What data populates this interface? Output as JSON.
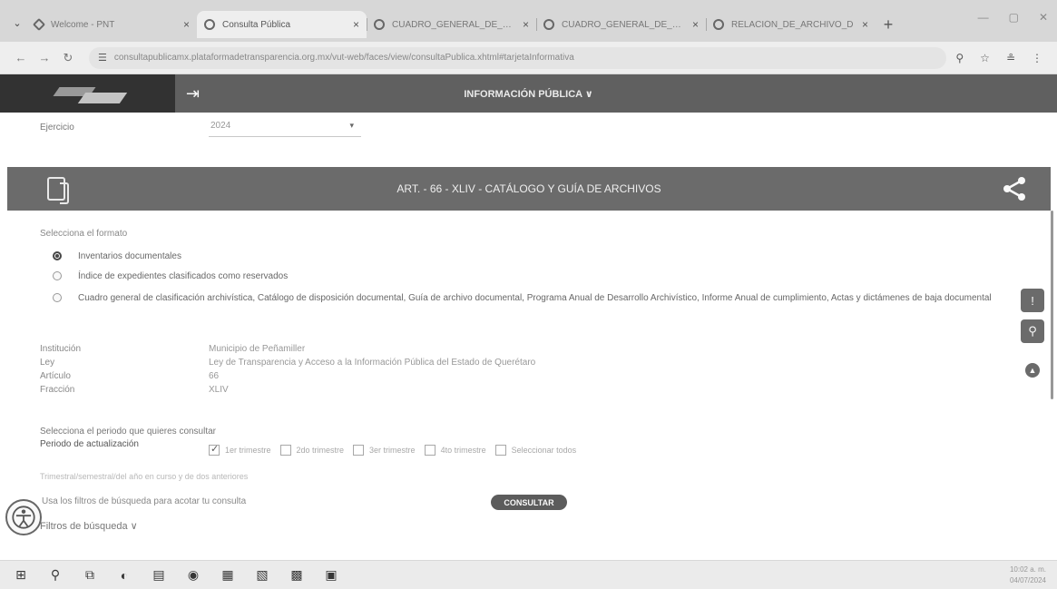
{
  "browser": {
    "tabs": [
      {
        "title": "Welcome - PNT",
        "active": false
      },
      {
        "title": "Consulta Pública",
        "active": true
      },
      {
        "title": "CUADRO_GENERAL_DE_ARC",
        "active": false
      },
      {
        "title": "CUADRO_GENERAL_DE_ARC",
        "active": false
      },
      {
        "title": "RELACIÓN_DE_ARCHIVO_D",
        "active": false
      }
    ],
    "url": "consultapublicamx.plataformadetransparencia.org.mx/vut-web/faces/view/consultaPublica.xhtml#tarjetaInformativa"
  },
  "header": {
    "title": "INFORMACIÓN PÚBLICA ∨"
  },
  "ejercicio": {
    "label": "Ejercicio",
    "value": "2024"
  },
  "section": {
    "title": "ART. - 66 - XLIV - CATÁLOGO Y GUÍA DE ARCHIVOS"
  },
  "formato": {
    "label": "Selecciona el formato",
    "options": [
      {
        "label": "Inventarios documentales",
        "checked": true
      },
      {
        "label": "Índice de expedientes clasificados como reservados",
        "checked": false
      },
      {
        "label": "Cuadro general de clasificación archivística, Catálogo de disposición documental, Guía de archivo documental, Programa Anual de Desarrollo Archivístico, Informe Anual de cumplimiento, Actas y dictámenes de baja documental",
        "checked": false
      }
    ]
  },
  "info": [
    {
      "key": "Institución",
      "value": "Municipio de Peñamiller"
    },
    {
      "key": "Ley",
      "value": "Ley de Transparencia y Acceso a la Información Pública del Estado de Querétaro"
    },
    {
      "key": "Artículo",
      "value": "66"
    },
    {
      "key": "Fracción",
      "value": "XLIV"
    }
  ],
  "periodo": {
    "hint": "Selecciona el periodo que quieres consultar",
    "label": "Periodo de actualización",
    "options": [
      {
        "label": "1er trimestre",
        "checked": true
      },
      {
        "label": "2do trimestre",
        "checked": false
      },
      {
        "label": "3er trimestre",
        "checked": false
      },
      {
        "label": "4to trimestre",
        "checked": false
      },
      {
        "label": "Seleccionar todos",
        "checked": false
      }
    ],
    "note": "Trimestral/semestral/del año en curso y de dos anteriores"
  },
  "filters": {
    "note": "Usa los filtros de búsqueda para acotar tu consulta",
    "button": "CONSULTAR",
    "toggle": "Filtros de búsqueda ∨"
  },
  "taskbar": {
    "time": "10:02 a. m.",
    "date": "04/07/2024"
  }
}
